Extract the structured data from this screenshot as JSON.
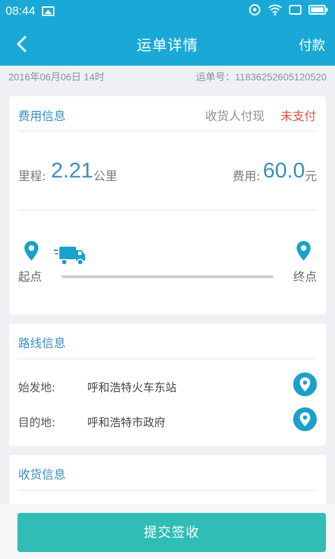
{
  "status_bar": {
    "time": "08:44",
    "icons": [
      "image-icon",
      "nfc-icon",
      "wifi-icon",
      "screen-icon",
      "battery-icon"
    ]
  },
  "app_bar": {
    "back_icon": "chevron-left-icon",
    "title": "运单详情",
    "action": "付款"
  },
  "meta": {
    "date": "2016年06月06日 14时",
    "order_no": "运单号：11836252605120520"
  },
  "fee_card": {
    "heading": "费用信息",
    "payer": "收货人付现",
    "pay_status": "未支付",
    "mileage_label": "里程:",
    "mileage_value": "2.21",
    "mileage_unit": "公里",
    "fee_label": "费用:",
    "fee_value": "60.0",
    "fee_unit": "元",
    "start_label": "起点",
    "end_label": "终点",
    "progress": 0
  },
  "route_card": {
    "heading": "路线信息",
    "rows": [
      {
        "label": "始发地:",
        "value": "呼和浩特火车东站"
      },
      {
        "label": "目的地:",
        "value": "呼和浩特市政府"
      }
    ]
  },
  "receive_card": {
    "heading": "收货信息"
  },
  "footer": {
    "submit_label": "提交签收"
  },
  "colors": {
    "header": "#1aa9d6",
    "accent_blue": "#3a8ec0",
    "status_red": "#e0513a",
    "submit_teal": "#2fbdb5"
  }
}
